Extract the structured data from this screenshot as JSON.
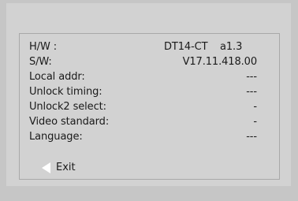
{
  "info": {
    "hw_label": "H/W :",
    "hw_model": "DT14-CT",
    "hw_revision": "a1.3",
    "sw_label": "S/W:",
    "sw_value": "V17.11.418.00",
    "local_addr_label": "Local addr:",
    "local_addr_value": "---",
    "unlock_timing_label": "Unlock timing:",
    "unlock_timing_value": "---",
    "unlock2_select_label": "Unlock2 select:",
    "unlock2_select_value": "-",
    "video_standard_label": "Video standard:",
    "video_standard_value": "-",
    "language_label": "Language:",
    "language_value": "---"
  },
  "exit": {
    "label": "Exit",
    "icon": "left-arrow-icon"
  },
  "colors": {
    "background": "#c6c6c6",
    "panel": "#d2d2d2",
    "border": "#a9a9a9",
    "text": "#1a1a1a",
    "arrow": "#ffffff"
  }
}
